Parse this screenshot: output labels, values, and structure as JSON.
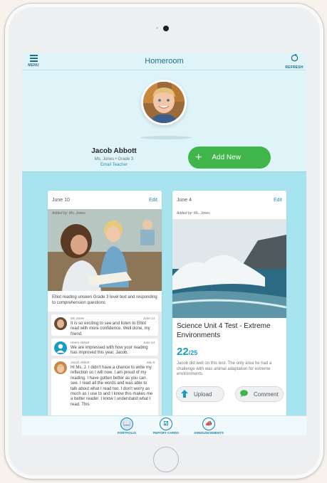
{
  "nav": {
    "menu_label": "MENU",
    "title": "Homeroom",
    "refresh_label": "REFRESH"
  },
  "student": {
    "name": "Jacob Abbott",
    "teacher_grade": "Ms. Jones • Grade 3",
    "email_label": "Email Teacher"
  },
  "actions": {
    "add_new": "Add New"
  },
  "card1": {
    "date": "June 10",
    "edit": "Edit",
    "added_by": "Added by: Ms. Jones",
    "caption": "Elliot reading unseen Grade 3 level text and responding to comprehension questions",
    "comments": [
      {
        "author": "Ms Jones",
        "date": "June 14",
        "text": "It is so exciting to see and listen to Elliot read with more confidence. Well done, my friend."
      },
      {
        "author": "Heeni Abbott",
        "date": "June 14",
        "text": "We are impressed with how your reading has improved this year, Jacob."
      },
      {
        "author": "Jacob Abbott",
        "date": "July 8",
        "text": "Hi Ms. J. I didn't have a chance to write my reflection so I will now. I am proud of my reading. I have gotten better as you can see. I read all the words and was able to talk about what I read too. I don't worry as much as I use to and I know this makes me a better reader. I know I understand what I read. This"
      }
    ]
  },
  "card2": {
    "date": "June 4",
    "edit": "Edit",
    "added_by": "Added by: Ms. Jones",
    "title": "Science Unit 4 Test - Extreme Environments",
    "score": "22",
    "score_total": "/25",
    "description": "Jacob did well on this test. The only area he had a challenge with was animal adaptation for extreme environments.",
    "upload_label": "Upload",
    "comment_label": "Comment"
  },
  "tabs": [
    {
      "label": "PORTFOLIO",
      "icon": "book-icon"
    },
    {
      "label": "REPORT CARDS",
      "icon": "report-card-icon"
    },
    {
      "label": "ANNOUNCEMENTS",
      "icon": "megaphone-icon"
    }
  ],
  "colors": {
    "accent": "#1a7fb0",
    "add_button": "#3fb54a",
    "background": "#a7e4f0",
    "header": "#dff4f8"
  }
}
